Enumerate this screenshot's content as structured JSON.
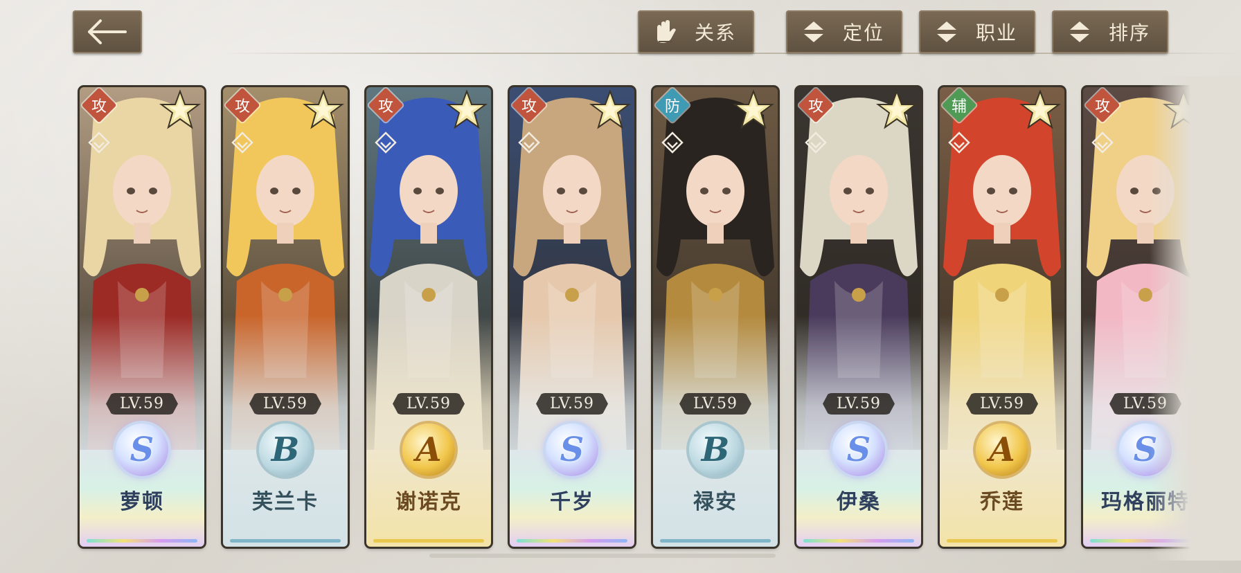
{
  "toolbar": {
    "back_icon": "arrow-left-icon",
    "buttons": [
      {
        "label": "关系",
        "icon": "gloves-icon"
      },
      {
        "label": "定位",
        "icon": "sort-arrows-icon"
      },
      {
        "label": "职业",
        "icon": "sort-arrows-icon"
      },
      {
        "label": "排序",
        "icon": "sort-arrows-icon"
      }
    ]
  },
  "characters": [
    {
      "name": "萝顿",
      "role": "攻",
      "level": "LV.59",
      "rank": "S",
      "stars": 1,
      "hair": "#e9d6a4",
      "outfit": "#9c2a25",
      "bg": "#b29c82"
    },
    {
      "name": "芙兰卡",
      "role": "攻",
      "level": "LV.59",
      "rank": "B",
      "stars": 1,
      "hair": "#f1c65a",
      "outfit": "#c9652b",
      "bg": "#a48f6c"
    },
    {
      "name": "谢诺克",
      "role": "攻",
      "level": "LV.59",
      "rank": "A",
      "stars": 1,
      "hair": "#3b5bb8",
      "outfit": "#d9d4c8",
      "bg": "#5f7780"
    },
    {
      "name": "千岁",
      "role": "攻",
      "level": "LV.59",
      "rank": "S",
      "stars": 1,
      "hair": "#c9a77e",
      "outfit": "#e6c9ad",
      "bg": "#3b4e73"
    },
    {
      "name": "禄安",
      "role": "防",
      "level": "LV.59",
      "rank": "B",
      "stars": 1,
      "hair": "#2a2420",
      "outfit": "#b48a3e",
      "bg": "#6e5a44"
    },
    {
      "name": "伊桑",
      "role": "攻",
      "level": "LV.59",
      "rank": "S",
      "stars": 1,
      "hair": "#dcd6c4",
      "outfit": "#4a3b5c",
      "bg": "#3a3530"
    },
    {
      "name": "乔莲",
      "role": "辅",
      "level": "LV.59",
      "rank": "A",
      "stars": 1,
      "hair": "#d2442c",
      "outfit": "#efd47a",
      "bg": "#7a5e45"
    },
    {
      "name": "玛格丽特",
      "role": "攻",
      "level": "LV.59",
      "rank": "S",
      "stars": 1,
      "hair": "#f0cf86",
      "outfit": "#f2b8c4",
      "bg": "#5c4a44"
    }
  ]
}
